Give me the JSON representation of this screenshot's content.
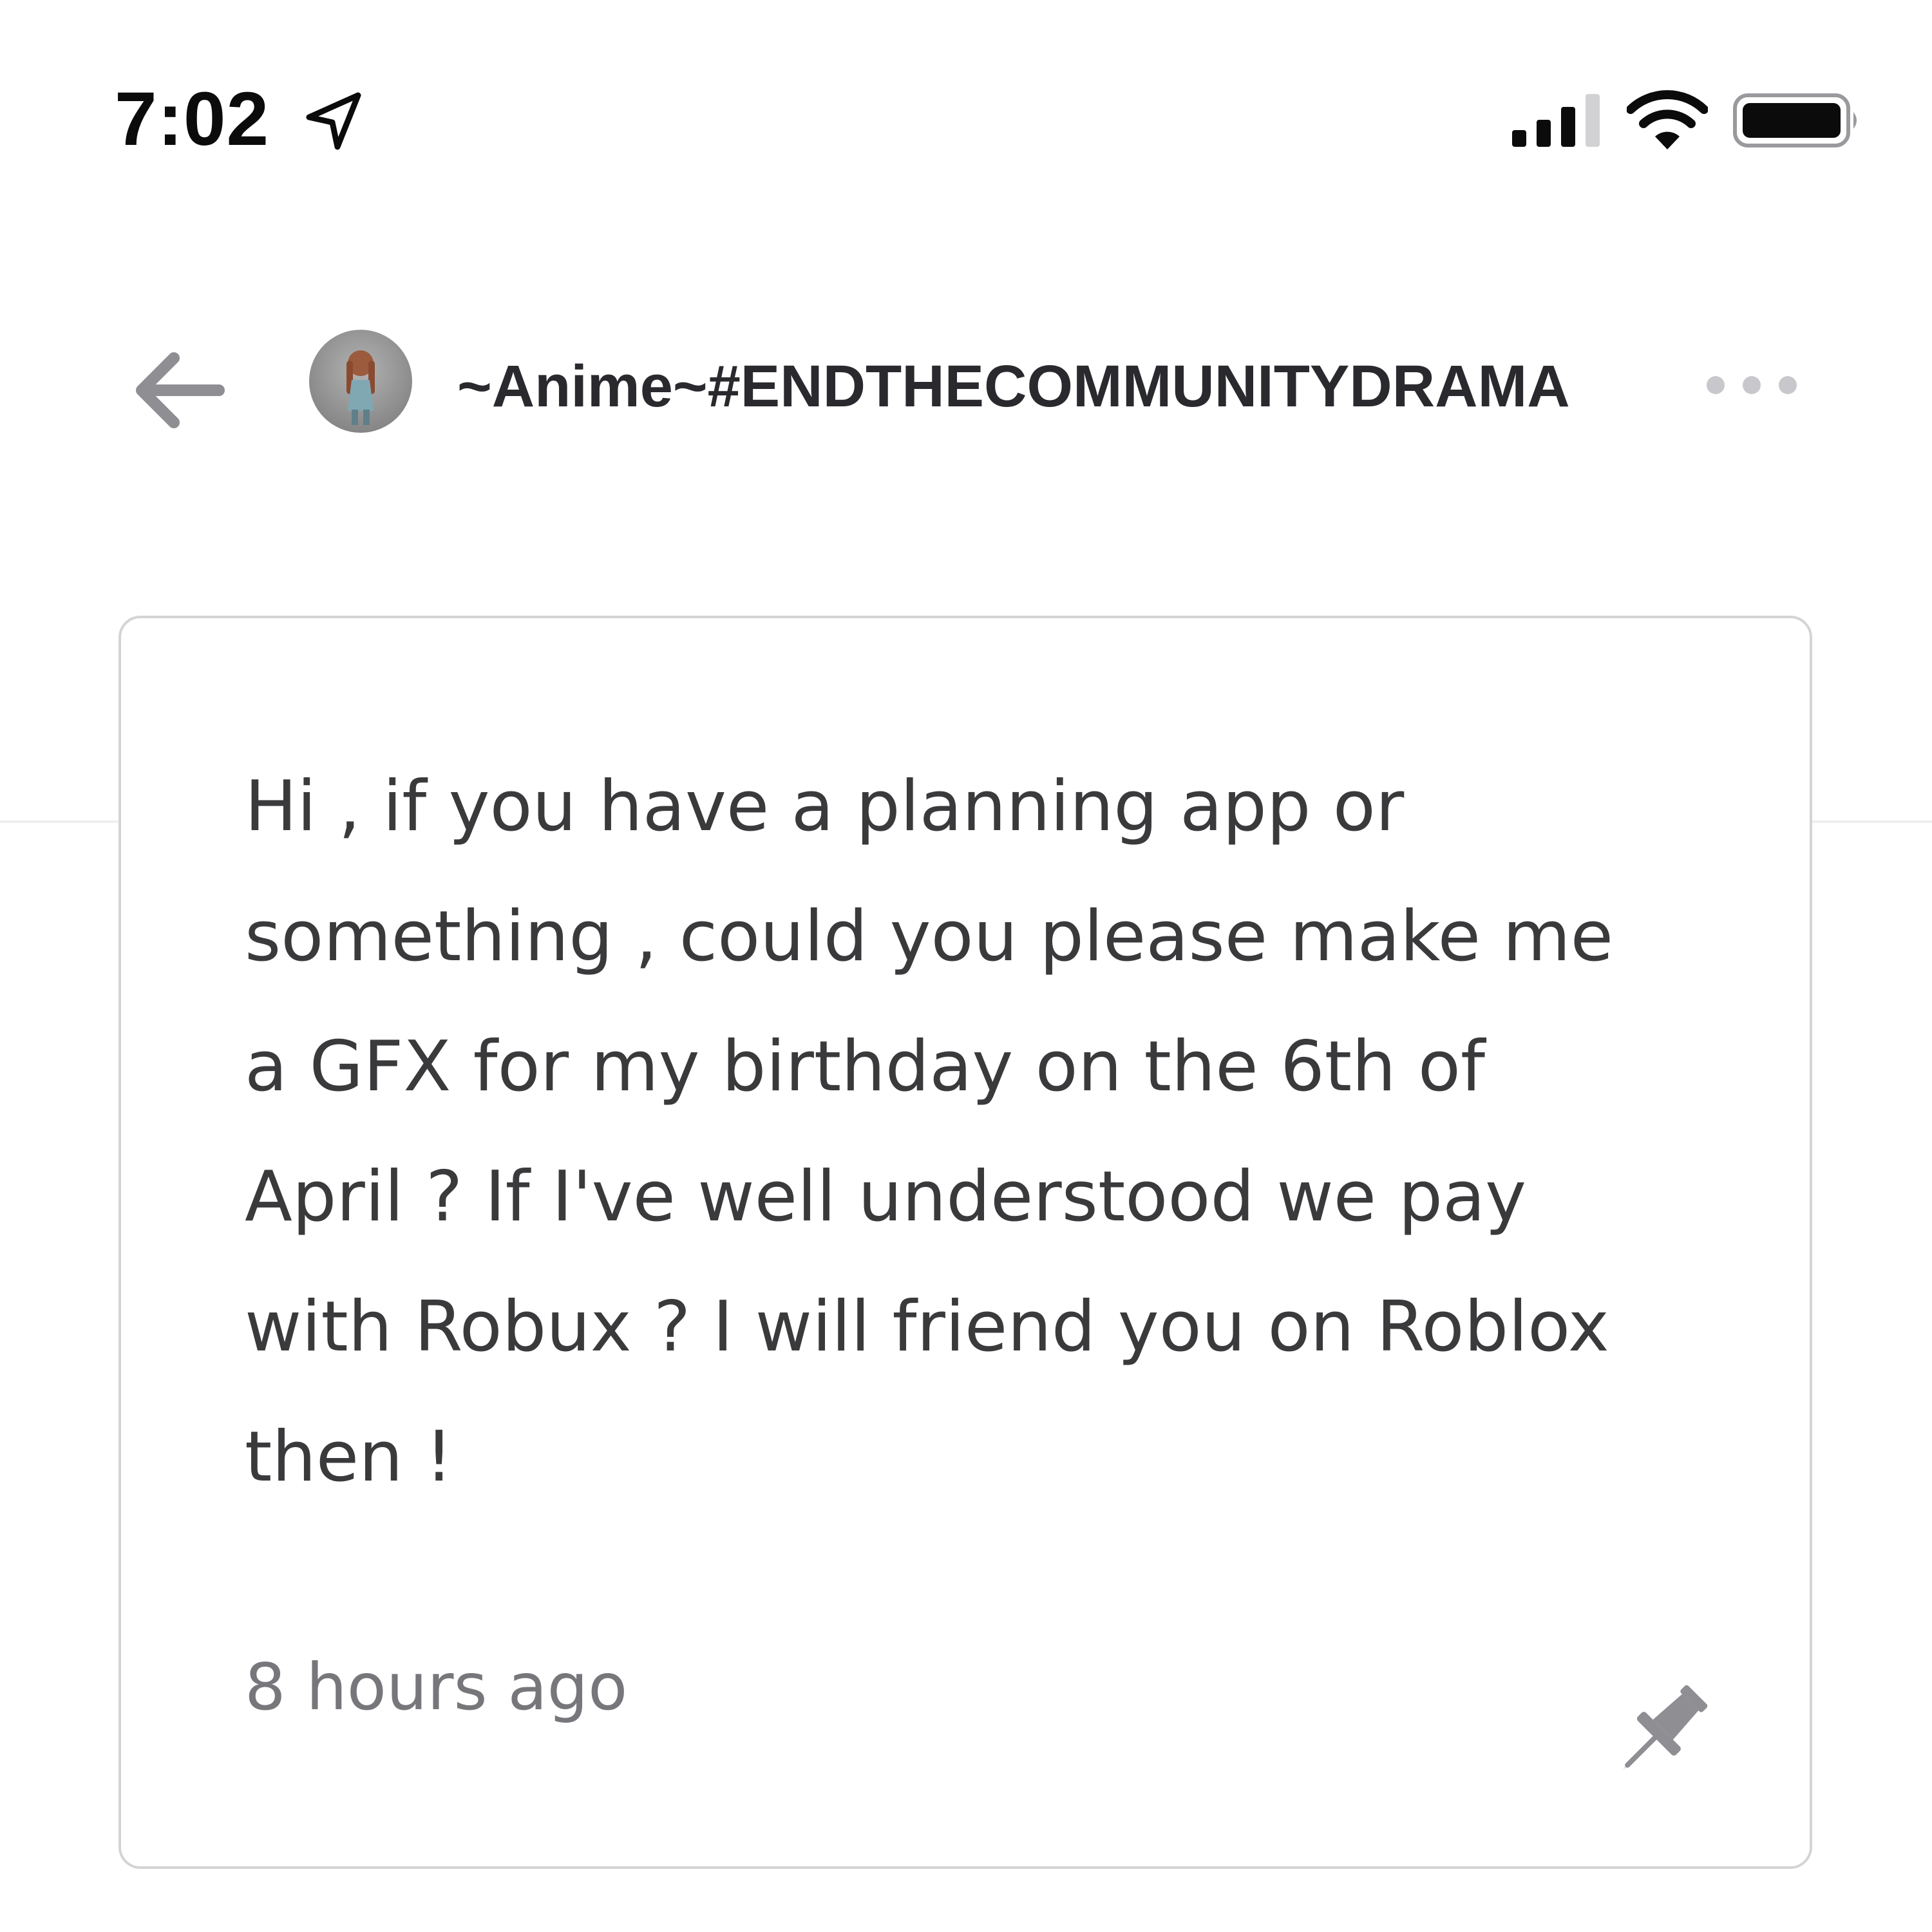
{
  "status_bar": {
    "time": "7:02",
    "icons": [
      "location-arrow-icon",
      "cellular-signal-icon",
      "wifi-icon",
      "battery-icon"
    ]
  },
  "header": {
    "back_icon": "arrow-left-icon",
    "title": "~Anime~#ENDTHECOMMUNITYDRAMA",
    "more_icon": "ellipsis-icon"
  },
  "message": {
    "lines": [
      "Hi , if you have a planning app or",
      "something , could you please make me",
      "a GFX for my birthday on the 6th of",
      "April ? If I've well understood we pay",
      "with Robux ? I will friend you on Roblox",
      "then !"
    ],
    "timestamp": "8 hours ago",
    "pin_icon": "pushpin-icon"
  },
  "colors": {
    "text_primary": "#3a3a3c",
    "text_secondary": "#77777b",
    "icon_gray": "#8e8e93",
    "border": "#d4d4d6"
  }
}
